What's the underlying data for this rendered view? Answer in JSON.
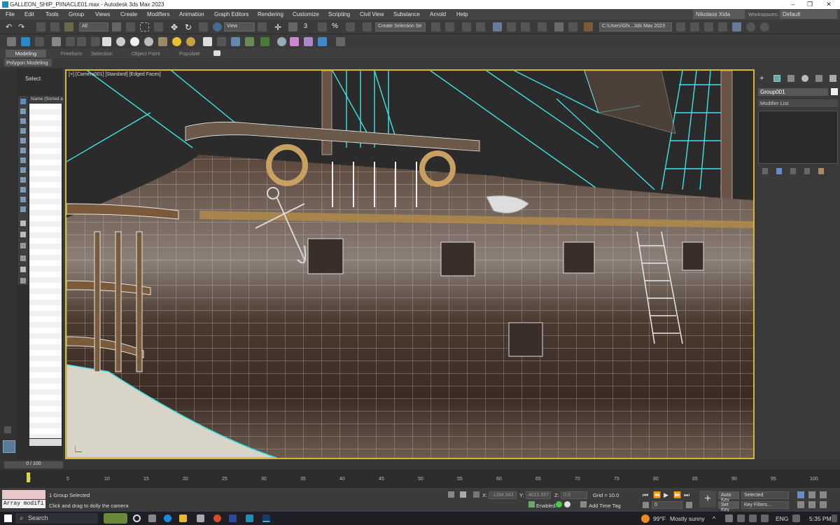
{
  "window": {
    "title": "GALLEON_SHIP_PIINACLE01.max - Autodesk 3ds Max 2023"
  },
  "menu": [
    "File",
    "Edit",
    "Tools",
    "Group",
    "Views",
    "Create",
    "Modifiers",
    "Animation",
    "Graph Editors",
    "Rendering",
    "Customize",
    "Scripting",
    "Civil View",
    "Substance",
    "Arnold",
    "Help"
  ],
  "account": {
    "user": "Nikolaos Xida",
    "workspaces_label": "Workspaces:",
    "workspace": "Default"
  },
  "toolbar": {
    "filter": "All",
    "ref_coord": "View",
    "selection_set": "Create Selection Se",
    "project_path": "C:\\Users\\Gfx...3ds Max 2023"
  },
  "ribbon": {
    "tabs": [
      "Modeling",
      "Freeform",
      "Selection",
      "Object Paint",
      "Populate"
    ],
    "active": "Modeling",
    "panel": "Polygon Modeling"
  },
  "scene_explorer": {
    "select_label": "Select",
    "column": "Name (Sorted a"
  },
  "viewport": {
    "label": "[+] [Camera001] [Standard] [Edged Faces]"
  },
  "command_panel": {
    "object_name": "Group001",
    "modifier_list": "Modifier List"
  },
  "timeline": {
    "frame": "0 / 100",
    "ticks": [
      "0",
      "5",
      "10",
      "15",
      "20",
      "25",
      "30",
      "35",
      "40",
      "45",
      "50",
      "55",
      "60",
      "65",
      "70",
      "75",
      "80",
      "85",
      "90",
      "95",
      "100"
    ]
  },
  "status": {
    "selection": "1 Group Selected",
    "prompt": "Click and drag to dolly the camera",
    "maxscript": "Array modifi",
    "x_label": "X:",
    "x_val": "-1394.943",
    "y_label": "Y:",
    "y_val": "4015.557",
    "z_label": "Z:",
    "z_val": "0.0",
    "grid": "Grid = 10.0",
    "enabled": "Enabled:",
    "add_time_tag": "Add Time Tag",
    "auto_key": "Auto Key",
    "set_key": "Set Key",
    "selected": "Selected",
    "key_filters": "Key Filters...",
    "frame_field": "0"
  },
  "taskbar": {
    "search": "Search",
    "weather": "99°F",
    "weather_desc": "Mostly sunny",
    "lang": "ENG",
    "time": "5:35 PM"
  }
}
